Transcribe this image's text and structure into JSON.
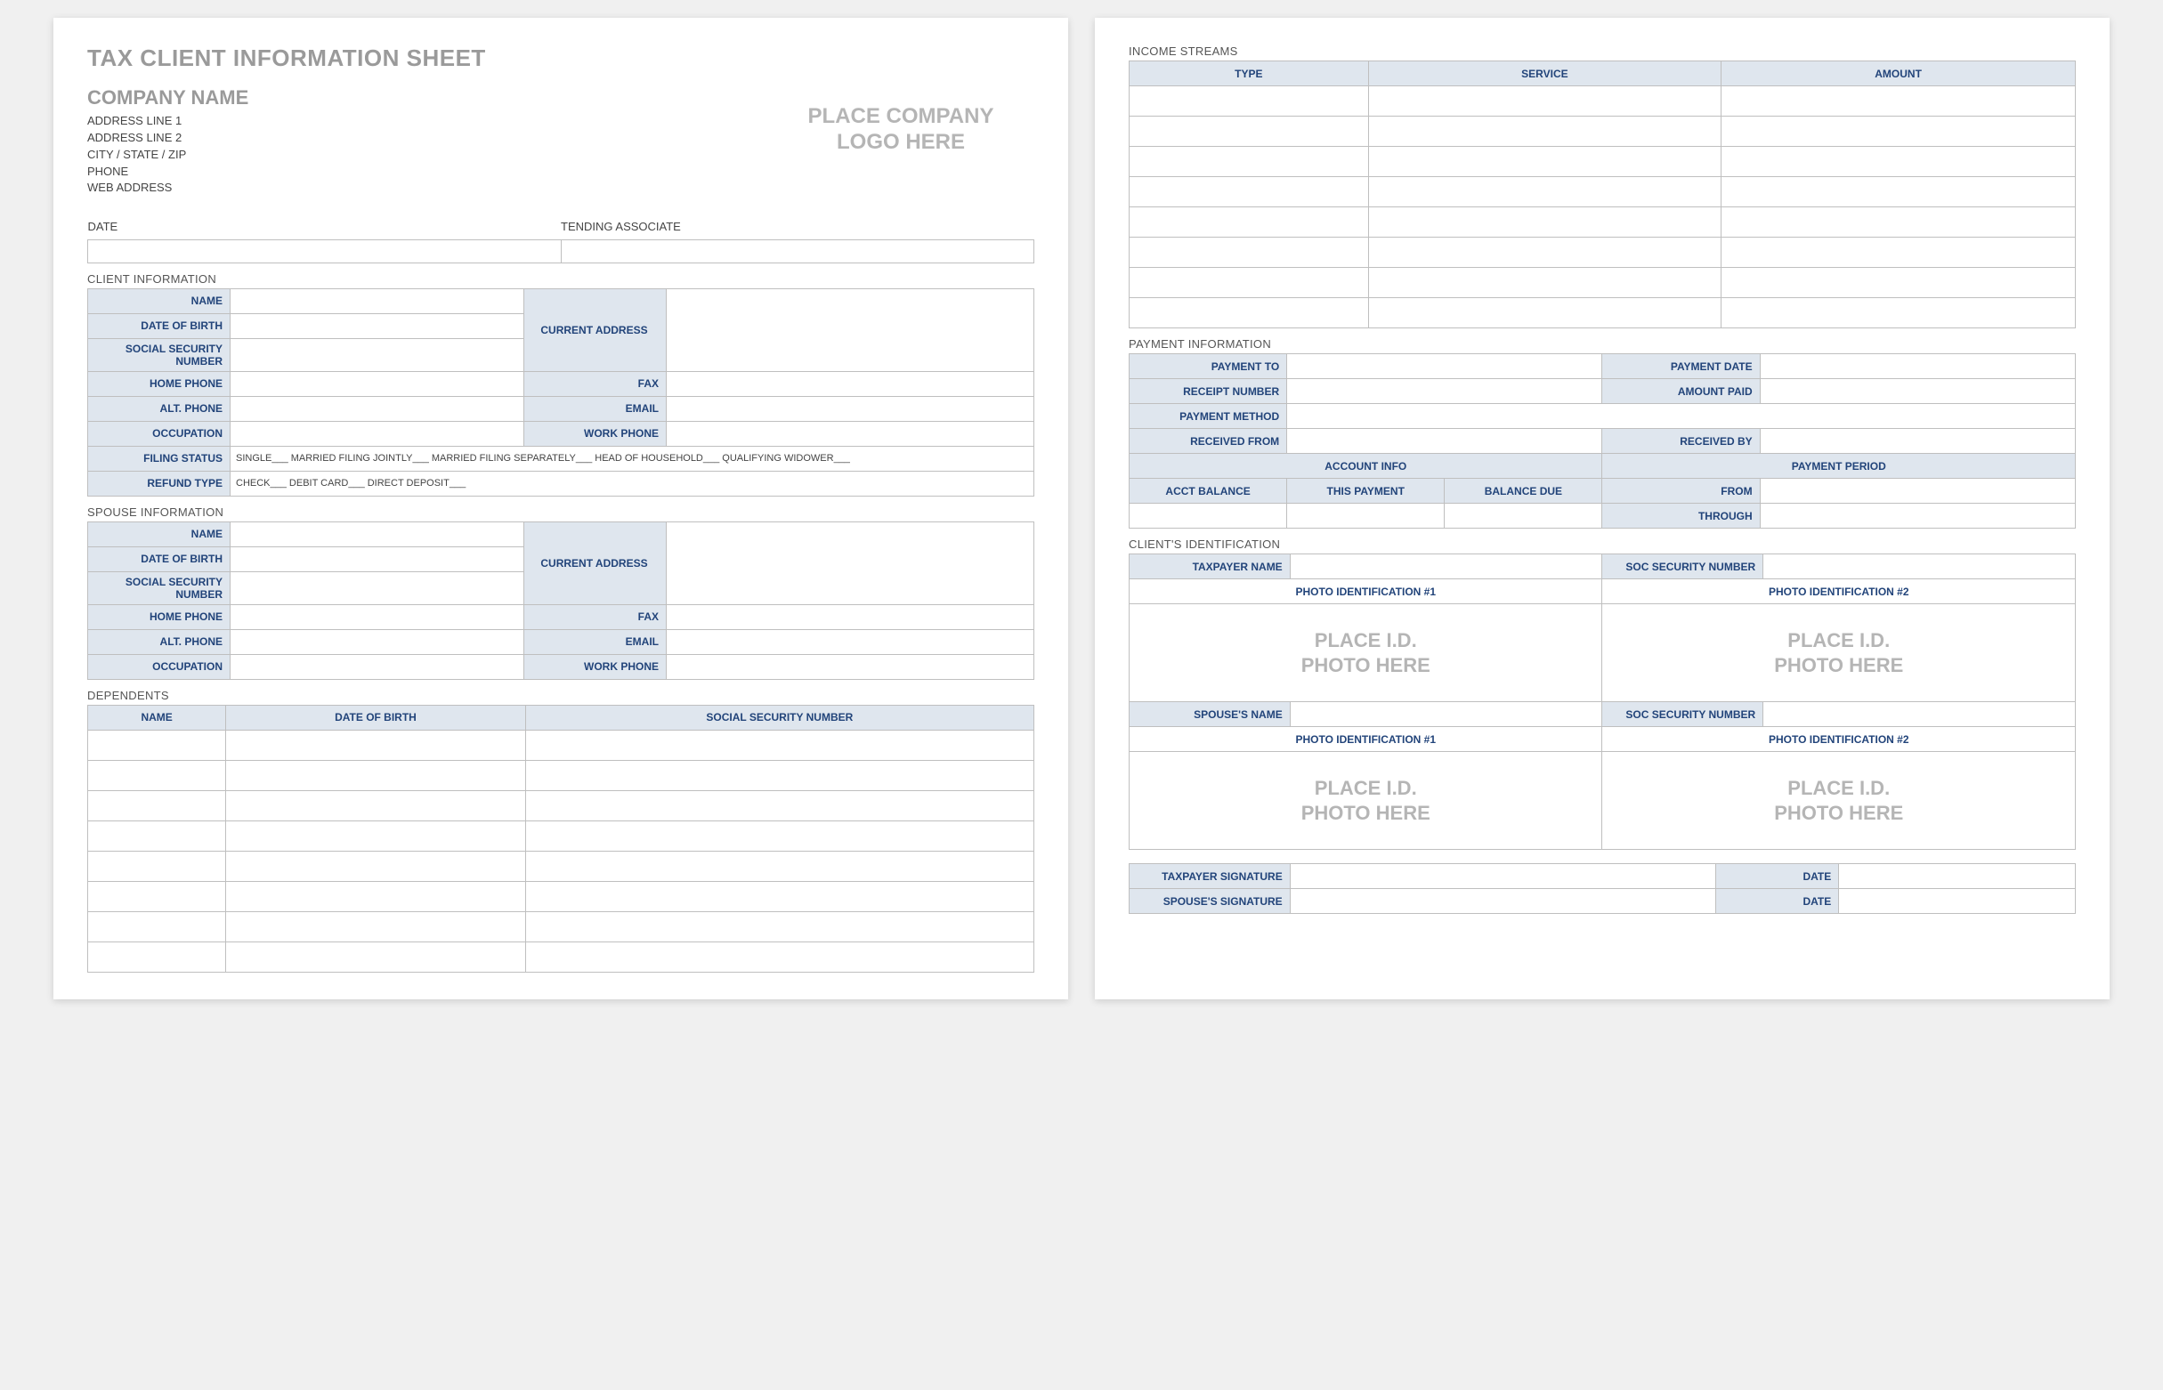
{
  "doc": {
    "title": "TAX CLIENT INFORMATION SHEET",
    "company_name": "COMPANY NAME",
    "addr1": "ADDRESS LINE 1",
    "addr2": "ADDRESS LINE 2",
    "citystate": "CITY / STATE / ZIP",
    "phone": "PHONE",
    "web": "WEB ADDRESS",
    "logo_placeholder_l1": "PLACE COMPANY",
    "logo_placeholder_l2": "LOGO HERE"
  },
  "labels": {
    "date": "DATE",
    "tending_associate": "TENDING ASSOCIATE",
    "client_info": "CLIENT INFORMATION",
    "spouse_info": "SPOUSE INFORMATION",
    "dependents": "DEPENDENTS",
    "name": "NAME",
    "dob": "DATE OF BIRTH",
    "ssn": "SOCIAL SECURITY NUMBER",
    "home_phone": "HOME PHONE",
    "alt_phone": "ALT. PHONE",
    "occupation": "OCCUPATION",
    "current_address": "CURRENT ADDRESS",
    "fax": "FAX",
    "email": "EMAIL",
    "work_phone": "WORK PHONE",
    "filing_status": "FILING STATUS",
    "refund_type": "REFUND TYPE",
    "filing_options": "SINGLE___   MARRIED FILING JOINTLY___   MARRIED FILING SEPARATELY___   HEAD OF HOUSEHOLD___   QUALIFYING WIDOWER___",
    "refund_options": "CHECK___   DEBIT CARD___   DIRECT DEPOSIT___",
    "income_streams": "INCOME STREAMS",
    "type": "TYPE",
    "service": "SERVICE",
    "amount": "AMOUNT",
    "payment_info": "PAYMENT INFORMATION",
    "payment_to": "PAYMENT TO",
    "payment_date": "PAYMENT DATE",
    "receipt_number": "RECEIPT NUMBER",
    "amount_paid": "AMOUNT PAID",
    "payment_method": "PAYMENT METHOD",
    "received_from": "RECEIVED FROM",
    "received_by": "RECEIVED BY",
    "account_info": "ACCOUNT INFO",
    "payment_period": "PAYMENT PERIOD",
    "acct_balance": "ACCT BALANCE",
    "this_payment": "THIS PAYMENT",
    "balance_due": "BALANCE DUE",
    "from": "FROM",
    "through": "THROUGH",
    "clients_identification": "CLIENT'S IDENTIFICATION",
    "taxpayer_name": "TAXPAYER NAME",
    "soc_security_number": "SOC SECURITY NUMBER",
    "photo_id_1": "PHOTO IDENTIFICATION #1",
    "photo_id_2": "PHOTO IDENTIFICATION #2",
    "spouses_name": "SPOUSE'S NAME",
    "place_id_l1": "PLACE I.D.",
    "place_id_l2": "PHOTO HERE",
    "taxpayer_signature": "TAXPAYER SIGNATURE",
    "spouses_signature": "SPOUSE'S SIGNATURE",
    "date_short": "DATE"
  }
}
